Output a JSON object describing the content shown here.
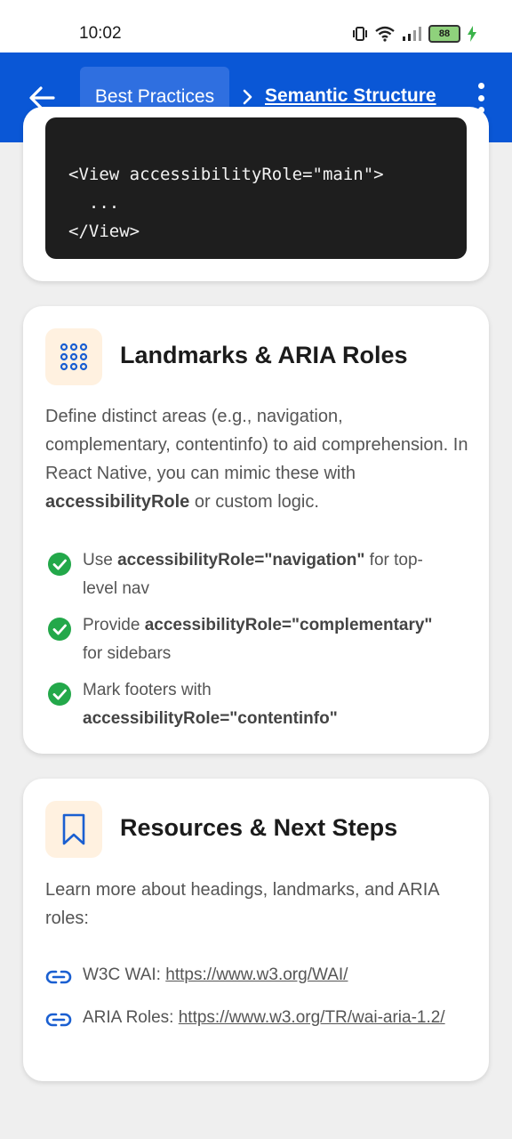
{
  "status_bar": {
    "time": "10:02",
    "battery": "88"
  },
  "app_bar": {
    "crumb_parent": "Best Practices",
    "crumb_current": "Semantic Structure"
  },
  "code_card": {
    "lines": [
      "<View accessibilityRole=\"main\">",
      "  ...",
      "</View>"
    ]
  },
  "landmarks": {
    "title": "Landmarks & ARIA Roles",
    "intro_pre": "Define distinct areas (e.g., navigation, complementary, contentinfo) to aid comprehension. In React Native, you can mimic these with ",
    "intro_bold": "accessibilityRole",
    "intro_post": " or custom logic.",
    "items": [
      {
        "pre": "Use ",
        "bold": "accessibilityRole=\"navigation\"",
        "post": " for top-level nav"
      },
      {
        "pre": "Provide ",
        "bold": "accessibilityRole=\"complementary\"",
        "post": " for sidebars"
      },
      {
        "pre": "Mark footers with ",
        "bold": "accessibilityRole=\"contentinfo\"",
        "post": ""
      }
    ]
  },
  "resources": {
    "title": "Resources & Next Steps",
    "intro": "Learn more about headings, landmarks, and ARIA roles:",
    "links": [
      {
        "label": "W3C WAI: ",
        "url": "https://www.w3.org/WAI/"
      },
      {
        "label": "ARIA Roles: ",
        "url": "https://www.w3.org/TR/wai-aria-1.2/"
      }
    ]
  },
  "colors": {
    "app_bar": "#0a57d6",
    "check": "#23a84a",
    "link_icon": "#1a5fd1",
    "icon_bg": "#fff1e0"
  }
}
